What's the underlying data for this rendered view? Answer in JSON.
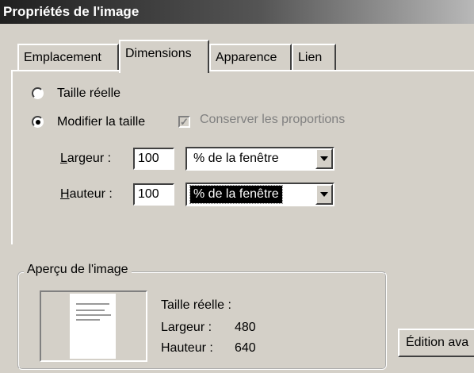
{
  "window": {
    "title": "Propriétés de l'image"
  },
  "tabs": [
    {
      "label": "Emplacement",
      "active": false
    },
    {
      "label": "Dimensions",
      "active": true
    },
    {
      "label": "Apparence",
      "active": false
    },
    {
      "label": "Lien",
      "active": false
    }
  ],
  "size_mode": {
    "options": [
      {
        "label": "Taille réelle",
        "selected": false
      },
      {
        "label": "Modifier la taille",
        "selected": true
      }
    ],
    "keep_proportions": {
      "label": "Conserver les proportions",
      "checked": true,
      "disabled": true
    }
  },
  "width": {
    "label_accel": "L",
    "label_rest": "argeur :",
    "value": "100",
    "unit": "% de la fenêtre"
  },
  "height": {
    "label_accel": "H",
    "label_rest": "auteur :",
    "value": "100",
    "unit": "% de la fenêtre"
  },
  "preview": {
    "legend": "Aperçu de l'image",
    "info_title": "Taille réelle :",
    "width_label": "Largeur :",
    "width_value": "480",
    "height_label": "Hauteur :",
    "height_value": "640"
  },
  "buttons": {
    "advanced_edit": "Édition ava"
  },
  "icons": {
    "check": "check-icon",
    "dropdown": "chevron-down-icon"
  }
}
